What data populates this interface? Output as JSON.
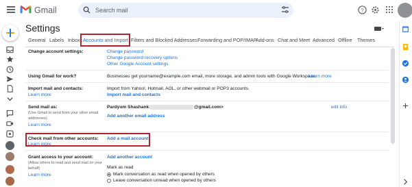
{
  "app": {
    "name": "Gmail"
  },
  "search": {
    "placeholder": "Search mail"
  },
  "page": {
    "title": "Settings"
  },
  "tabs": [
    {
      "label": "General"
    },
    {
      "label": "Labels"
    },
    {
      "label": "Inbox"
    },
    {
      "label": "Accounts and Import",
      "active": true
    },
    {
      "label": "Filters and Blocked Addresses"
    },
    {
      "label": "Forwarding and POP/IMAP"
    },
    {
      "label": "Add-ons"
    },
    {
      "label": "Chat and Meet"
    },
    {
      "label": "Advanced"
    },
    {
      "label": "Offline"
    },
    {
      "label": "Themes"
    }
  ],
  "sections": {
    "change_account": {
      "label": "Change account settings:",
      "links": [
        "Change password",
        "Change password recovery options",
        "Other Google Account settings"
      ]
    },
    "work": {
      "label": "Using Gmail for work?",
      "text": "Businesses get yourname@example.com email, more storage, and admin tools with Google Workspace.",
      "link": "Learn more"
    },
    "import": {
      "label": "Import mail and contacts:",
      "learn_more": "Learn more",
      "text": "Import from Yahoo!, Hotmail, AOL, or other webmail or POP3 accounts.",
      "action": "Import mail and contacts"
    },
    "send_as": {
      "label": "Send mail as:",
      "desc": [
        "(Use Gmail to send from your other email",
        "addresses)"
      ],
      "learn_more": "Learn more",
      "name": "Pardyum Shashanks",
      "email_suffix": "@gmail.com>",
      "edit": "edit info",
      "add": "Add another email address"
    },
    "check_mail": {
      "label": "Check mail from other accounts:",
      "learn_more": "Learn more",
      "action": "Add a mail account"
    },
    "grant_access": {
      "label": "Grant access to your account:",
      "desc": [
        "(Allow others to read and send mail on your",
        "behalf)"
      ],
      "learn_more": "Learn more",
      "action": "Add another account",
      "mark_as_read": "Mark as read",
      "options": [
        {
          "label": "Mark conversation as read when opened by others",
          "selected": true
        },
        {
          "label": "Leave conversation unread when opened by others",
          "selected": false
        }
      ]
    }
  },
  "colors": {
    "accent": "#1a73e8",
    "highlight_box": "#b3242e",
    "search_bg": "#eaf1fb"
  }
}
